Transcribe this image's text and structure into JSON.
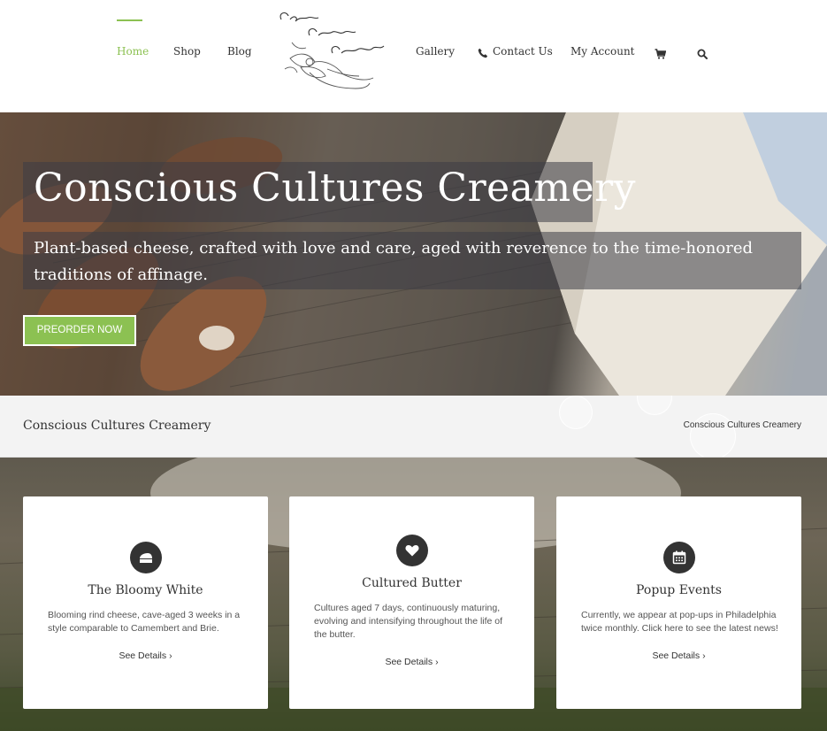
{
  "nav": {
    "home": "Home",
    "shop": "Shop",
    "blog": "Blog",
    "gallery": "Gallery",
    "contact": "Contact Us",
    "account": "My Account",
    "logo_alt": "Conscious Cultures Creamery",
    "accent_color": "#8cc152",
    "icons": [
      "phone-icon",
      "cart-icon",
      "search-icon"
    ]
  },
  "hero": {
    "title": "Conscious Cultures Creamery",
    "subtitle": "Plant-based cheese, crafted with love and care, aged with reverence to the time-honored traditions of affinage.",
    "button": "PREORDER NOW"
  },
  "page_title_bar": {
    "title": "Conscious Cultures Creamery",
    "breadcrumb": "Conscious Cultures Creamery"
  },
  "cards": [
    {
      "icon": "cheese-icon",
      "title": "The Bloomy White",
      "text": "Blooming rind cheese, cave-aged 3 weeks in a style comparable to Camembert and Brie.",
      "link": "See Details"
    },
    {
      "icon": "heart-icon",
      "title": "Cultured Butter",
      "text": "Cultures aged 7 days, continuously maturing, evolving and intensifying throughout the life of the butter.",
      "link": "See Details"
    },
    {
      "icon": "calendar-icon",
      "title": "Popup Events",
      "text": "Currently, we appear at pop-ups in Philadelphia twice monthly. Click here to see the latest news!",
      "link": "See Details"
    }
  ]
}
